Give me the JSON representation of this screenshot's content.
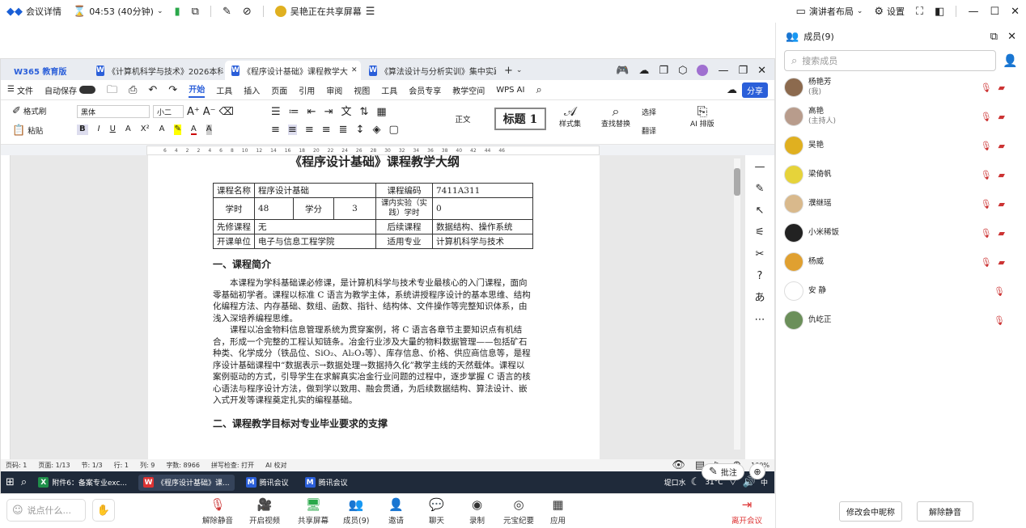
{
  "topbar": {
    "meeting_details": "会议详情",
    "timer": "04:53 (40分钟)",
    "sharing_notice": "吴艳正在共享屏幕",
    "presenter_layout": "演讲者布局",
    "settings": "设置"
  },
  "wps": {
    "brand": "W365 教育版",
    "tabs": [
      {
        "label": "《计算机科学与技术》2026本科人才"
      },
      {
        "label": "《程序设计基础》课程教学大"
      },
      {
        "label": "《算法设计与分析实训》集中实践"
      }
    ],
    "menu": [
      "文件",
      "自动保存",
      "开始",
      "工具",
      "插入",
      "页面",
      "引用",
      "审阅",
      "视图",
      "工具",
      "会员专享",
      "教学空间",
      "WPS AI"
    ],
    "share_label": "分享",
    "ribbon": {
      "format_painter": "格式刷",
      "paste": "粘贴",
      "font_name": "黑体",
      "font_size": "小二",
      "style_normal": "正文",
      "style_heading": "标题 1",
      "style_set": "样式集",
      "find_replace": "查找替换",
      "select": "选择",
      "translate": "翻译",
      "ai_layout": "AI 排版"
    },
    "ruler_ticks": [
      "6",
      "4",
      "2",
      "2",
      "4",
      "6",
      "8",
      "10",
      "12",
      "14",
      "16",
      "18",
      "20",
      "22",
      "24",
      "26",
      "28",
      "30",
      "32",
      "34",
      "36",
      "38",
      "40",
      "42",
      "44",
      "46"
    ],
    "document": {
      "title": "《程序设计基础》课程教学大纲",
      "table": [
        [
          "课程名称",
          "程序设计基础",
          "",
          "",
          "课程编码",
          "7411A311"
        ],
        [
          "学时",
          "48",
          "学分",
          "3",
          "课内实验（实践）学时",
          "0"
        ],
        [
          "先修课程",
          "无",
          "",
          "",
          "后续课程",
          "数据结构、操作系统"
        ],
        [
          "开课单位",
          "电子与信息工程学院",
          "",
          "",
          "适用专业",
          "计算机科学与技术"
        ]
      ],
      "section1": "一、课程简介",
      "para1": "本课程为学科基础课必修课，是计算机科学与技术专业最核心的入门课程，面向零基础初学者。课程以标准 C 语言为教学主体，系统讲授程序设计的基本思维、结构化编程方法、内存基础、数组、函数、指针、结构体、文件操作等完整知识体系，由浅入深培养编程思维。",
      "para2": "课程以冶金物料信息管理系统为贯穿案例，将 C 语言各章节主要知识点有机结合，形成一个完整的工程认知链条。冶金行业涉及大量的物料数据管理——包括矿石种类、化学成分（铁品位、SiO₂、Al₂O₃等）、库存信息、价格、供应商信息等，是程序设计基础课程中“数据表示→数据处理→数据持久化”教学主线的天然载体。课程以案例驱动的方式，引导学生在求解真实冶金行业问题的过程中，逐步掌握 C 语言的核心语法与程序设计方法，做到学以致用、融会贯通，为后续数据结构、算法设计、嵌入式开发等课程奠定扎实的编程基础。",
      "section2": "二、课程教学目标对专业毕业要求的支撑"
    },
    "statusbar": {
      "page": "页码: 1",
      "pages": "页面: 1/13",
      "section": "节: 1/3",
      "line": "行: 1",
      "col": "列: 9",
      "words": "字数: 8966",
      "spell": "拼写检查: 打开",
      "proof": "AI 校对",
      "zoom": "100%",
      "annotate": "批注"
    }
  },
  "taskbar": {
    "items": [
      "附件6：备案专业exc...",
      "《程序设计基础》课...",
      "腾讯会议",
      "腾讯会议"
    ],
    "weather": "31°C",
    "location": "堤口水",
    "ime": "中"
  },
  "bottombar": {
    "chat_placeholder": "说点什么...",
    "buttons": [
      "解除静音",
      "开启视频",
      "共享屏幕",
      "成员(9)",
      "邀请",
      "聊天",
      "录制",
      "元宝纪要",
      "应用"
    ],
    "leave": "离开会议"
  },
  "panel": {
    "title": "成员(9)",
    "search_placeholder": "搜索成员",
    "members": [
      {
        "name": "杨艳芳",
        "sub": "(我)",
        "color": "#8c6a4e"
      },
      {
        "name": "高艳",
        "sub": "(主持人)",
        "color": "#b89c8c"
      },
      {
        "name": "吴艳",
        "sub": "",
        "color": "#e0b020"
      },
      {
        "name": "梁倚帆",
        "sub": "",
        "color": "#e6d33a"
      },
      {
        "name": "濮继瑶",
        "sub": "",
        "color": "#d9b98c"
      },
      {
        "name": "小米稀饭",
        "sub": "",
        "color": "#222222"
      },
      {
        "name": "杨威",
        "sub": "",
        "color": "#e0a030"
      },
      {
        "name": "安 静",
        "sub": "",
        "color": "#ffffff"
      },
      {
        "name": "仇屹正",
        "sub": "",
        "color": "#6b8f5a"
      }
    ],
    "rename_button": "修改会中昵称",
    "unmute_button": "解除静音"
  }
}
